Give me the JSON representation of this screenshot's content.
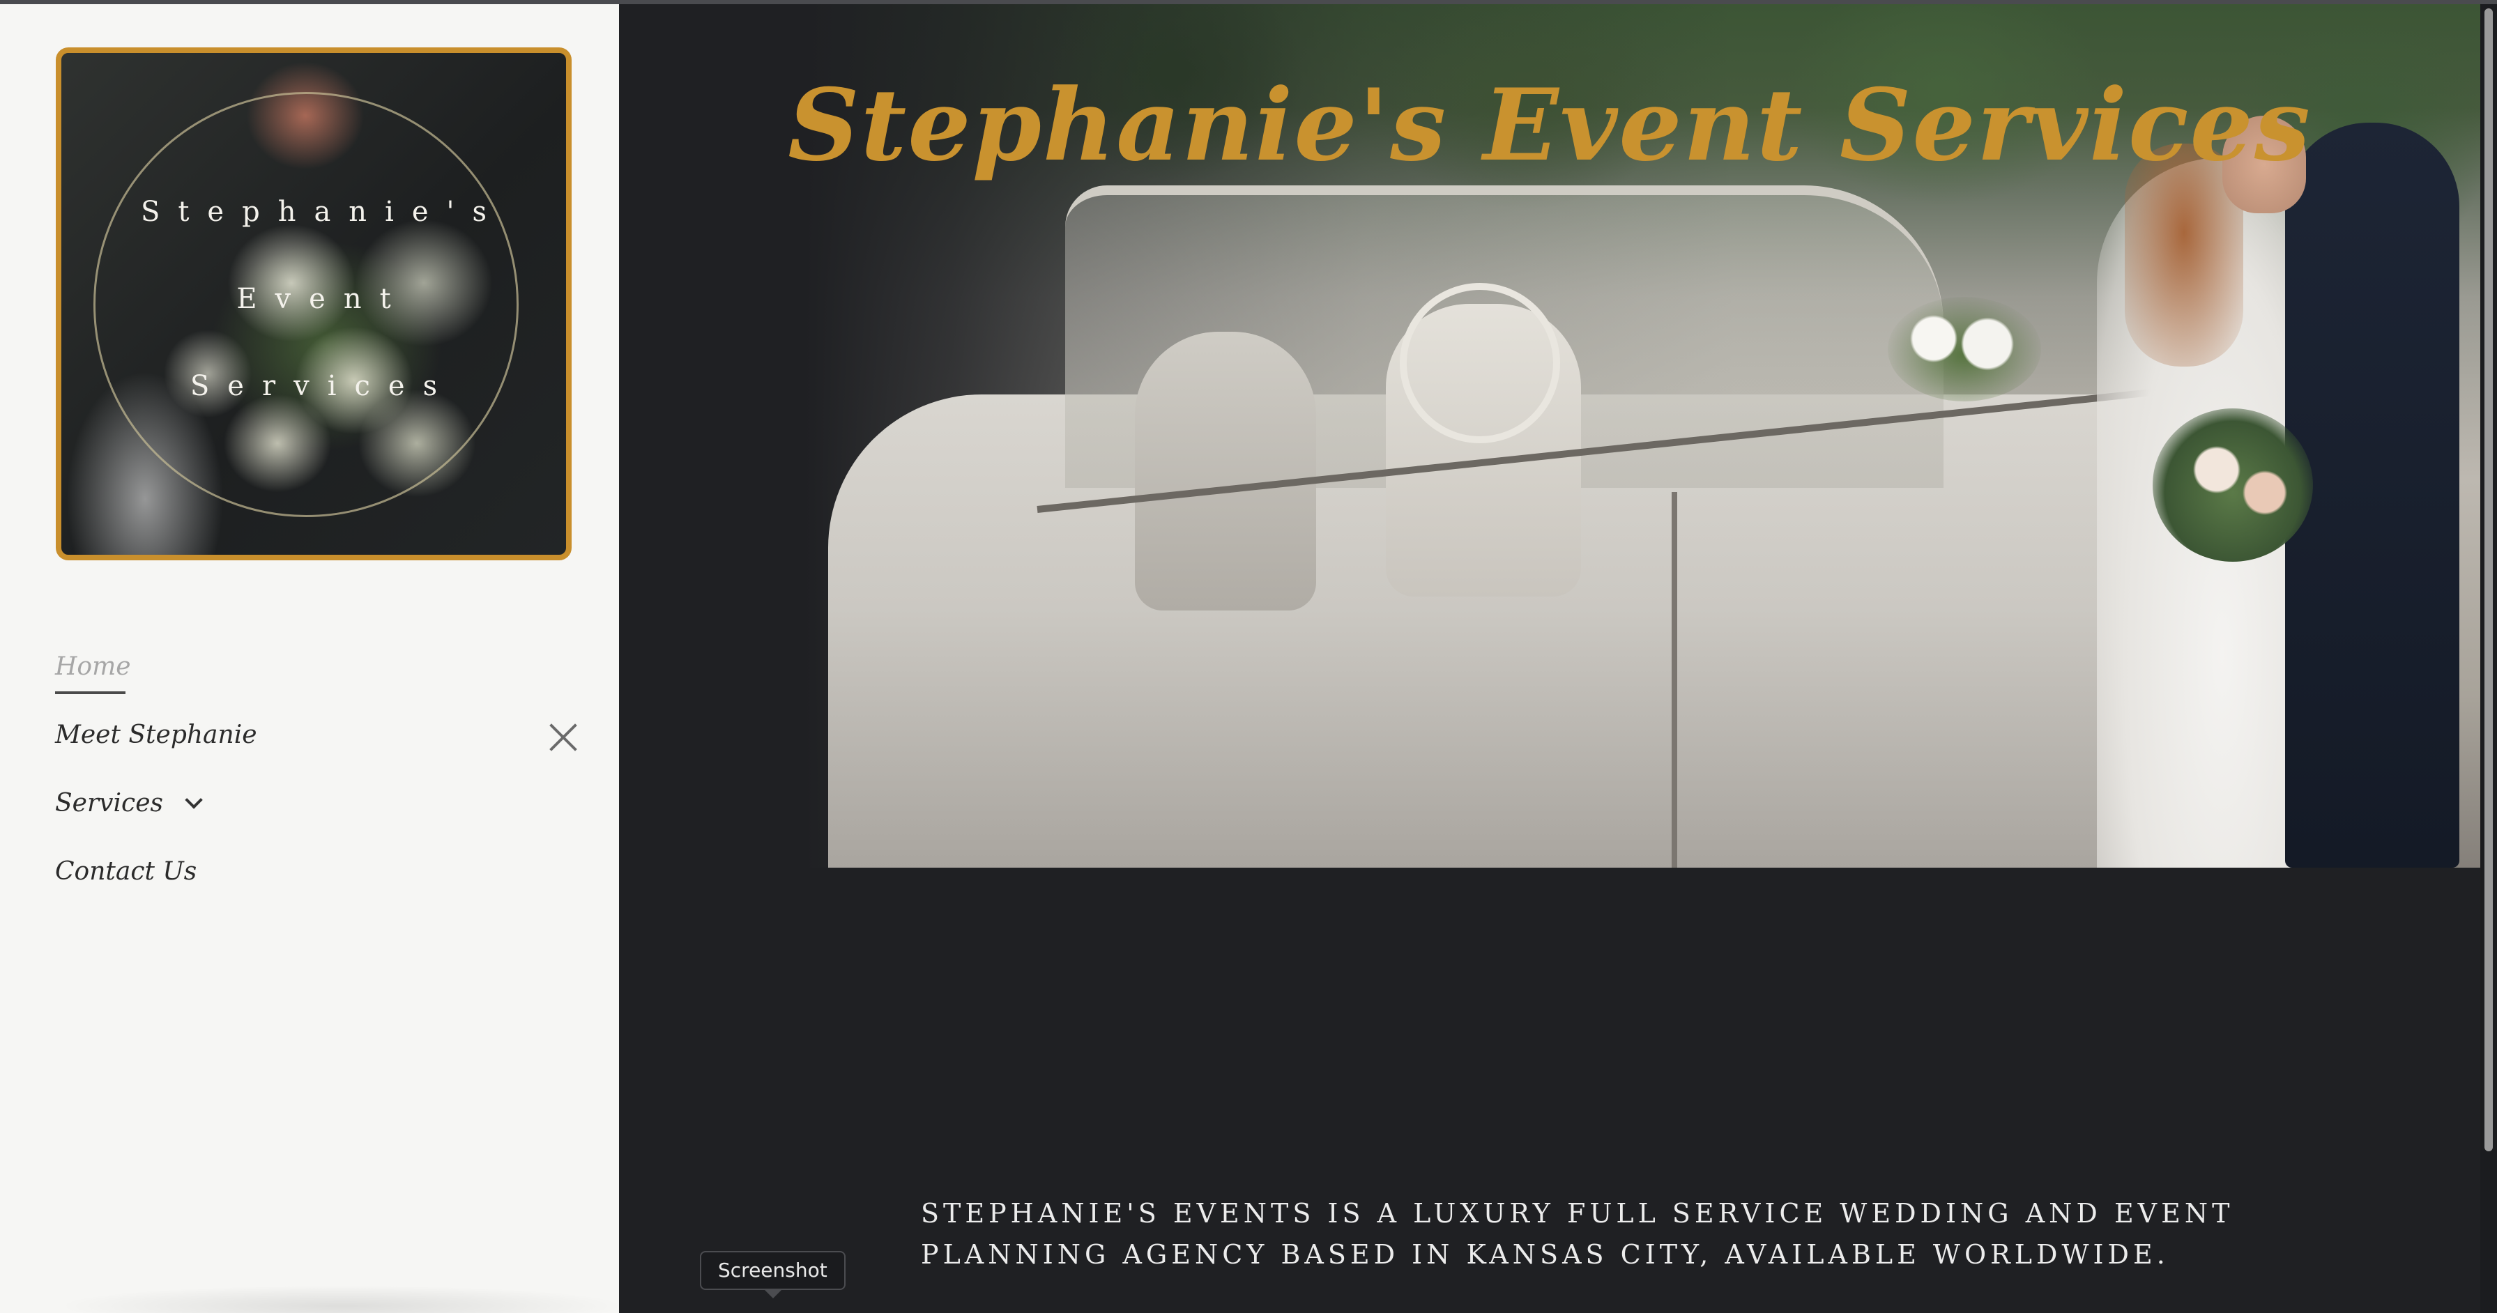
{
  "brand": {
    "logo_lines": [
      "Stephanie's",
      "Event",
      "Services"
    ],
    "accent_color": "#c98f2c"
  },
  "sidebar": {
    "nav": [
      {
        "label": "Home",
        "active": true
      },
      {
        "label": "Meet Stephanie"
      },
      {
        "label": "Services",
        "has_dropdown": true
      },
      {
        "label": "Contact Us"
      }
    ],
    "close_icon": "close-icon"
  },
  "hero": {
    "title": "Stephanie's Event Services",
    "title_color": "#c9922f"
  },
  "intro": {
    "line1": "STEPHANIE'S EVENTS IS A LUXURY FULL SERVICE WEDDING AND EVENT",
    "line2": "PLANNING AGENCY BASED IN KANSAS CITY, AVAILABLE WORLDWIDE."
  },
  "tooltip": {
    "label": "Screenshot"
  }
}
